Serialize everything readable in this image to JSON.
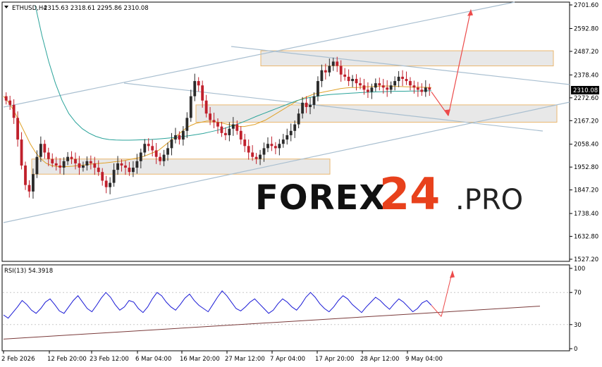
{
  "header": {
    "symbol": "ETHUSD,H4",
    "ohlc": "2315.63 2318.61 2295.86 2310.08",
    "rsi": "RSI(13) 54.3918"
  },
  "watermark": {
    "brand": "FOREX",
    "number": "24",
    "suffix": ".PRO"
  },
  "colors": {
    "bull": "#2b2b2b",
    "bear": "#c0202c",
    "ma_fast": "#e0a22a",
    "ma_slow": "#2aa39a",
    "channel": "#a9bfd0",
    "zone_fill": "#e6e6e6",
    "zone_border": "#e8b060",
    "arrow": "#ec4b4b",
    "rsi": "#1a1ad6",
    "rsi_trend": "#7a3a3a",
    "price_tag_bg": "#000000",
    "watermark_dark": "#111111",
    "watermark_accent": "#e8411c"
  },
  "chart_data": {
    "type": "candlestick",
    "symbol": "ETHUSD",
    "timeframe": "H4",
    "last_price": "2310.08",
    "price_ticks": [
      "2701.60",
      "2592.80",
      "2487.20",
      "2378.40",
      "2272.60",
      "2167.20",
      "2058.40",
      "1952.80",
      "1847.20",
      "1738.40",
      "1632.80",
      "1527.20"
    ],
    "time_labels": [
      "2 Feb 2026",
      "12 Feb 20:00",
      "23 Feb 12:00",
      "6 Mar 04:00",
      "16 Mar 20:00",
      "27 Mar 12:00",
      "7 Apr 04:00",
      "17 Apr 20:00",
      "28 Apr 12:00",
      "9 May 04:00"
    ],
    "ylim": [
      1527.2,
      2701.6
    ],
    "closes": [
      2260,
      2240,
      2180,
      2080,
      1960,
      1870,
      1840,
      1920,
      2000,
      2060,
      2020,
      1990,
      1970,
      1960,
      1950,
      1980,
      2000,
      1990,
      1970,
      1950,
      1960,
      1980,
      1970,
      1950,
      1930,
      1890,
      1860,
      1880,
      1940,
      1970,
      1960,
      1950,
      1930,
      1950,
      1980,
      2020,
      2060,
      2050,
      2030,
      2000,
      1980,
      2010,
      2040,
      2080,
      2100,
      2080,
      2120,
      2180,
      2280,
      2350,
      2330,
      2260,
      2200,
      2170,
      2160,
      2140,
      2110,
      2100,
      2130,
      2150,
      2120,
      2080,
      2050,
      2020,
      2000,
      1990,
      2010,
      2040,
      2060,
      2050,
      2040,
      2060,
      2080,
      2100,
      2120,
      2150,
      2200,
      2250,
      2230,
      2240,
      2280,
      2350,
      2400,
      2390,
      2420,
      2440,
      2420,
      2380,
      2370,
      2350,
      2360,
      2340,
      2330,
      2310,
      2300,
      2320,
      2340,
      2330,
      2320,
      2310,
      2330,
      2350,
      2370,
      2360,
      2350,
      2330,
      2320,
      2310,
      2300,
      2320,
      2310
    ],
    "ma_fast": [
      2280,
      2250,
      2210,
      2160,
      2110,
      2060,
      2020,
      1990,
      1970,
      1960,
      1955,
      1955,
      1955,
      1957,
      1960,
      1962,
      1965,
      1968,
      1970,
      1972,
      1975,
      1978,
      1980,
      1985,
      1990,
      1995,
      2000,
      2010,
      2020,
      2030,
      2050,
      2070,
      2090,
      2110,
      2130,
      2145,
      2155,
      2160,
      2165,
      2165,
      2160,
      2155,
      2150,
      2145,
      2140,
      2140,
      2145,
      2150,
      2160,
      2170,
      2185,
      2200,
      2215,
      2230,
      2245,
      2260,
      2270,
      2280,
      2290,
      2295,
      2300,
      2305,
      2310,
      2315,
      2318,
      2320,
      2320,
      2322,
      2324,
      2325,
      2326,
      2327,
      2327,
      2326,
      2325,
      2324,
      2323,
      2322,
      2322,
      2321,
      2320
    ],
    "ma_slow": [
      2700,
      2560,
      2440,
      2340,
      2260,
      2200,
      2160,
      2130,
      2110,
      2095,
      2085,
      2080,
      2078,
      2077,
      2077,
      2078,
      2079,
      2080,
      2082,
      2084,
      2087,
      2090,
      2094,
      2098,
      2103,
      2108,
      2115,
      2122,
      2130,
      2140,
      2150,
      2162,
      2175,
      2188,
      2200,
      2212,
      2224,
      2236,
      2248,
      2260,
      2268,
      2275,
      2280,
      2285,
      2288,
      2290,
      2292,
      2294,
      2296,
      2298,
      2299,
      2300,
      2301,
      2302,
      2303,
      2303,
      2304,
      2304,
      2305,
      2305
    ],
    "support_resistance_zones": [
      [
        2420,
        2490
      ],
      [
        2160,
        2240
      ],
      [
        1920,
        1990
      ]
    ],
    "projection": {
      "down_to": 2190,
      "up_to": 2680
    },
    "rsi": {
      "name": "RSI(13)",
      "last": "54.3918",
      "ticks": [
        "100",
        "70",
        "30",
        "0"
      ],
      "ylim": [
        0,
        100
      ],
      "values": [
        42,
        38,
        45,
        52,
        60,
        55,
        48,
        44,
        50,
        58,
        62,
        55,
        47,
        44,
        52,
        60,
        66,
        58,
        50,
        46,
        54,
        63,
        70,
        64,
        55,
        48,
        52,
        60,
        58,
        50,
        45,
        52,
        62,
        70,
        66,
        58,
        52,
        48,
        55,
        63,
        68,
        60,
        54,
        50,
        46,
        55,
        64,
        72,
        66,
        58,
        50,
        47,
        52,
        58,
        62,
        56,
        50,
        44,
        48,
        56,
        62,
        58,
        52,
        48,
        55,
        64,
        70,
        64,
        56,
        50,
        46,
        52,
        60,
        66,
        62,
        55,
        50,
        45,
        52,
        58,
        64,
        60,
        54,
        49,
        56,
        62,
        58,
        52,
        46,
        50,
        57,
        60,
        54
      ]
    }
  }
}
